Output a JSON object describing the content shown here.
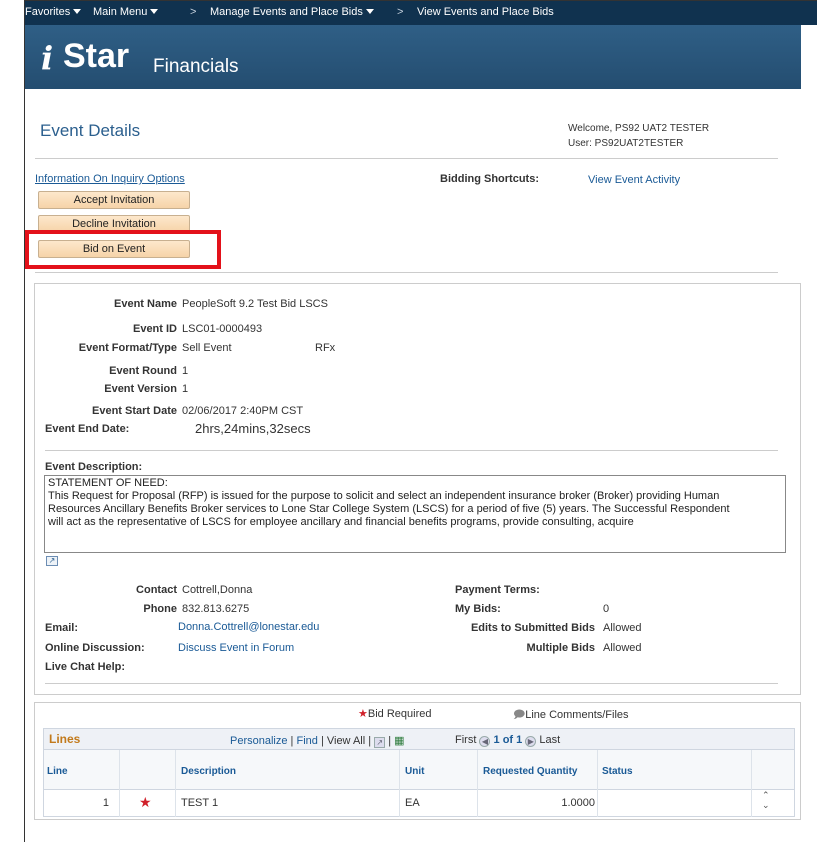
{
  "nav": {
    "favorites": "Favorites",
    "main_menu": "Main Menu",
    "sep1": ">",
    "crumb1": "Manage Events and Place Bids",
    "sep2": ">",
    "crumb2": "View Events and Place Bids"
  },
  "logo": {
    "i": "i",
    "star": "Star",
    "financials": "Financials"
  },
  "page": {
    "title": "Event Details",
    "welcome": "Welcome, PS92 UAT2 TESTER",
    "user": "User: PS92UAT2TESTER"
  },
  "actions": {
    "info_link": "Information On Inquiry Options",
    "accept": "Accept Invitation",
    "decline": "Decline Invitation",
    "bid": "Bid on Event",
    "shortcuts_label": "Bidding Shortcuts:",
    "view_activity": "View Event Activity"
  },
  "event": {
    "name_label": "Event Name",
    "name": "PeopleSoft 9.2 Test Bid LSCS",
    "id_label": "Event ID",
    "id": "LSC01-0000493",
    "format_label": "Event Format/Type",
    "format": "Sell Event",
    "type": "RFx",
    "round_label": "Event Round",
    "round": "1",
    "version_label": "Event Version",
    "version": "1",
    "start_label": "Event Start Date",
    "start": "02/06/2017  2:40PM CST",
    "end_label": "Event End Date:",
    "end": "2hrs,24mins,32secs",
    "desc_label": "Event Description:",
    "desc_line1": "STATEMENT OF NEED:",
    "desc_line2": "This Request for Proposal (RFP) is issued for the purpose to solicit and select an independent insurance broker (Broker) providing Human",
    "desc_line3": "Resources Ancillary Benefits Broker services to Lone Star College System (LSCS) for a period of five (5) years.  The Successful Respondent",
    "desc_line4": "will act as the representative of LSCS for employee ancillary and financial benefits programs, provide consulting, acquire"
  },
  "contact": {
    "contact_label": "Contact",
    "contact": "Cottrell,Donna",
    "phone_label": "Phone",
    "phone": "832.813.6275",
    "email_label": "Email:",
    "email": "Donna.Cottrell@lonestar.edu",
    "discussion_label": "Online Discussion:",
    "discussion": "Discuss Event in Forum",
    "chat_label": "Live Chat Help:",
    "payment_label": "Payment Terms:",
    "mybids_label": "My Bids:",
    "mybids": "0",
    "edits_label": "Edits to Submitted Bids",
    "edits": "Allowed",
    "multiple_label": "Multiple Bids",
    "multiple": "Allowed"
  },
  "lines": {
    "bid_required": "Bid Required",
    "line_comments": "Line Comments/Files",
    "title": "Lines",
    "personalize": "Personalize",
    "find": "Find",
    "view_all": "View All",
    "pipe": "|",
    "first": "First",
    "pager": "1 of 1",
    "last": "Last",
    "columns": [
      "Line",
      "Description",
      "Unit",
      "Requested Quantity",
      "Status"
    ],
    "rows": [
      {
        "line": "1",
        "description": "TEST 1",
        "unit": "EA",
        "qty": "1.0000",
        "status": ""
      }
    ]
  },
  "colors": {
    "nav": "#10324f",
    "banner": "#2f5f86",
    "link": "#1a5a96",
    "button": "#f6d3a8",
    "highlight": "#e3111a",
    "required_star": "#d0202a"
  }
}
